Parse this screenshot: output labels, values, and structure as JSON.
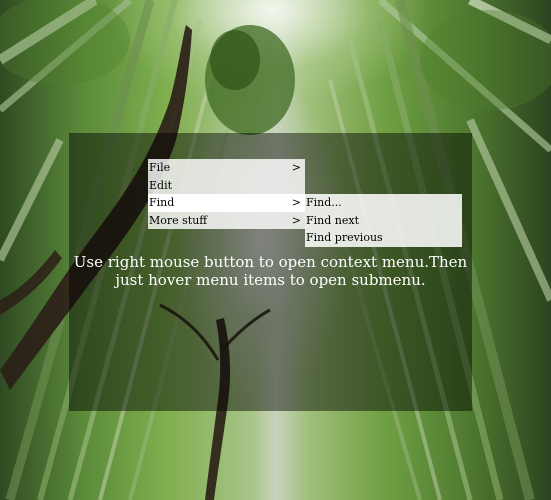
{
  "context_menu": {
    "items": [
      {
        "label": "File",
        "arrow": ">"
      },
      {
        "label": "Edit",
        "arrow": ""
      },
      {
        "label": "Find",
        "arrow": ">"
      },
      {
        "label": "More stuff",
        "arrow": ">"
      }
    ]
  },
  "submenu": {
    "items": [
      {
        "label": "Find..."
      },
      {
        "label": "Find next"
      },
      {
        "label": "Find previous"
      }
    ]
  },
  "caption": {
    "line1": "Use right mouse button to open context menu.Then",
    "line2": "just hover menu items to open submenu."
  }
}
